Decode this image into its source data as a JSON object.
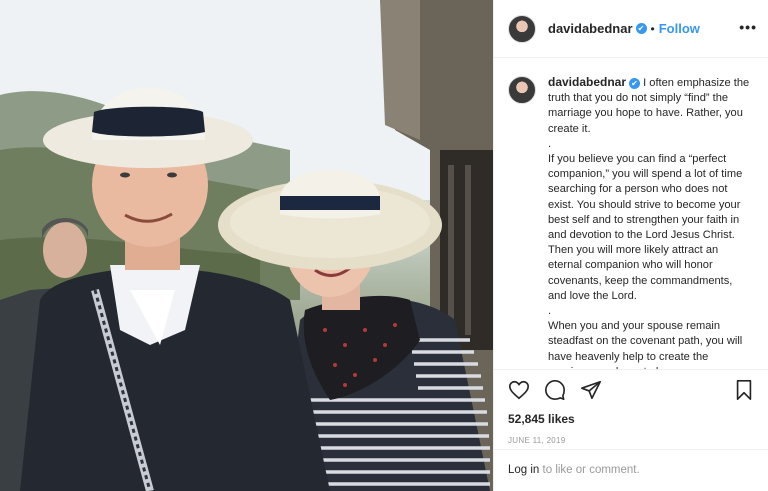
{
  "post": {
    "username": "davidabednar",
    "verified_badge": "✔",
    "separator": "•",
    "follow_label": "Follow",
    "more_label": "•••",
    "caption_lines": [
      "I often emphasize the truth that you do not simply “find” the marriage you hope to have. Rather, you create it.",
      ".",
      "If you believe you can find a “perfect companion,” you will spend a lot of time searching for a person who does not exist. You should strive to become your best self and to strengthen your faith in and devotion to the Lord Jesus Christ. Then you will more likely attract an eternal companion who will honor covenants, keep the commandments, and love the Lord.",
      ".",
      "When you and your spouse remain steadfast on the covenant path, you will have heavenly help to create the marriage you hope to have."
    ],
    "likes": "52,845 likes",
    "date": "JUNE 11, 2019",
    "login_link": "Log in",
    "login_rest": " to like or comment."
  },
  "icons": {
    "like": "heart-icon",
    "comment": "comment-icon",
    "share": "share-icon",
    "save": "bookmark-icon"
  },
  "colors": {
    "accent": "#3897f0",
    "text": "#262626",
    "muted": "#999999",
    "border": "#efefef"
  }
}
